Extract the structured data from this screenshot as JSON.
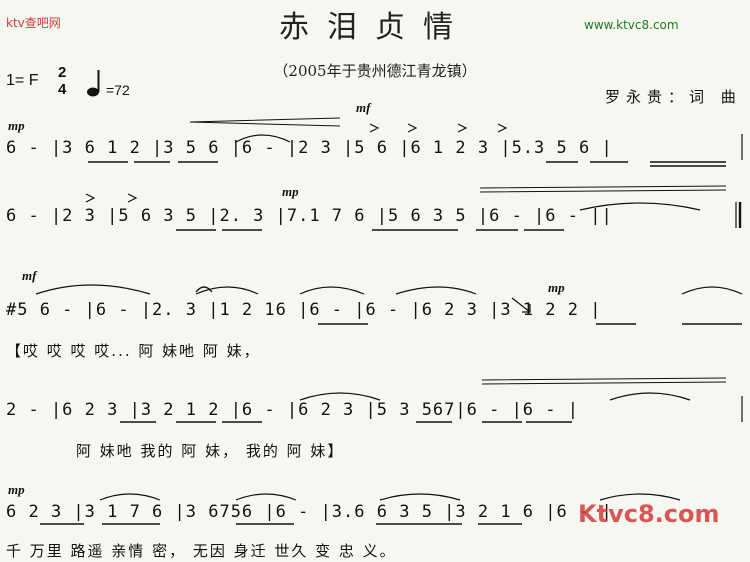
{
  "watermark_left": "ktv查吧网",
  "watermark_right": "www.ktvc8.com",
  "title": "赤泪贞情",
  "subtitle": "（2005年于贵州德江青龙镇）",
  "key": "1= F",
  "time_signature": {
    "top": "2",
    "bottom": "4"
  },
  "tempo": "=72",
  "credit": "罗永贵：词 曲",
  "staff": [
    {
      "dynamic": "mp",
      "dynamic2": "mf",
      "text": "6  -  |3 6  1 2 |3 5  6  |6   -  |2   3  |5   6  |6 1  2 3 |5.3 5 6 |"
    },
    {
      "dynamic": "mp",
      "text": "6  -  |2   3  |5 6  3 5 |2.  3  |7.1 7 6 |5 6  3 5 |6   -  |6   -  ||"
    },
    {
      "dynamic": "mf",
      "dynamic2": "mp",
      "text": "#5 6  -  |6   -  |2.  3  |1  2 16 |6   -  |6   -  |6  2 3 |3 1 2 2 |"
    },
    {
      "text": "2  -  |6  2 3 |3 2  1 2 |6  -  |6  2 3 |5 3  567|6   -  |6   -  |"
    },
    {
      "dynamic": "mp",
      "text": "6 2 3 |3 1 7 6 |3  6756 |6  -  |3.6 6 3 5 |3 2  1 6 |6  -  |"
    }
  ],
  "lyrics": [
    "【哎     哎    哎    哎...     阿 妹吔 阿  妹，",
    "阿  妹吔 我的 阿   妹，   我的 阿    妹】",
    "千 万里   路遥 亲情  密，  无因   身迁 世久 变 忠 义。"
  ],
  "logo_text": "Ktvc8.com",
  "colors": {
    "background": "#f7f7f2",
    "watermark_red": "#d23a3a",
    "watermark_green": "#1f7a1f",
    "ink": "#111111"
  }
}
